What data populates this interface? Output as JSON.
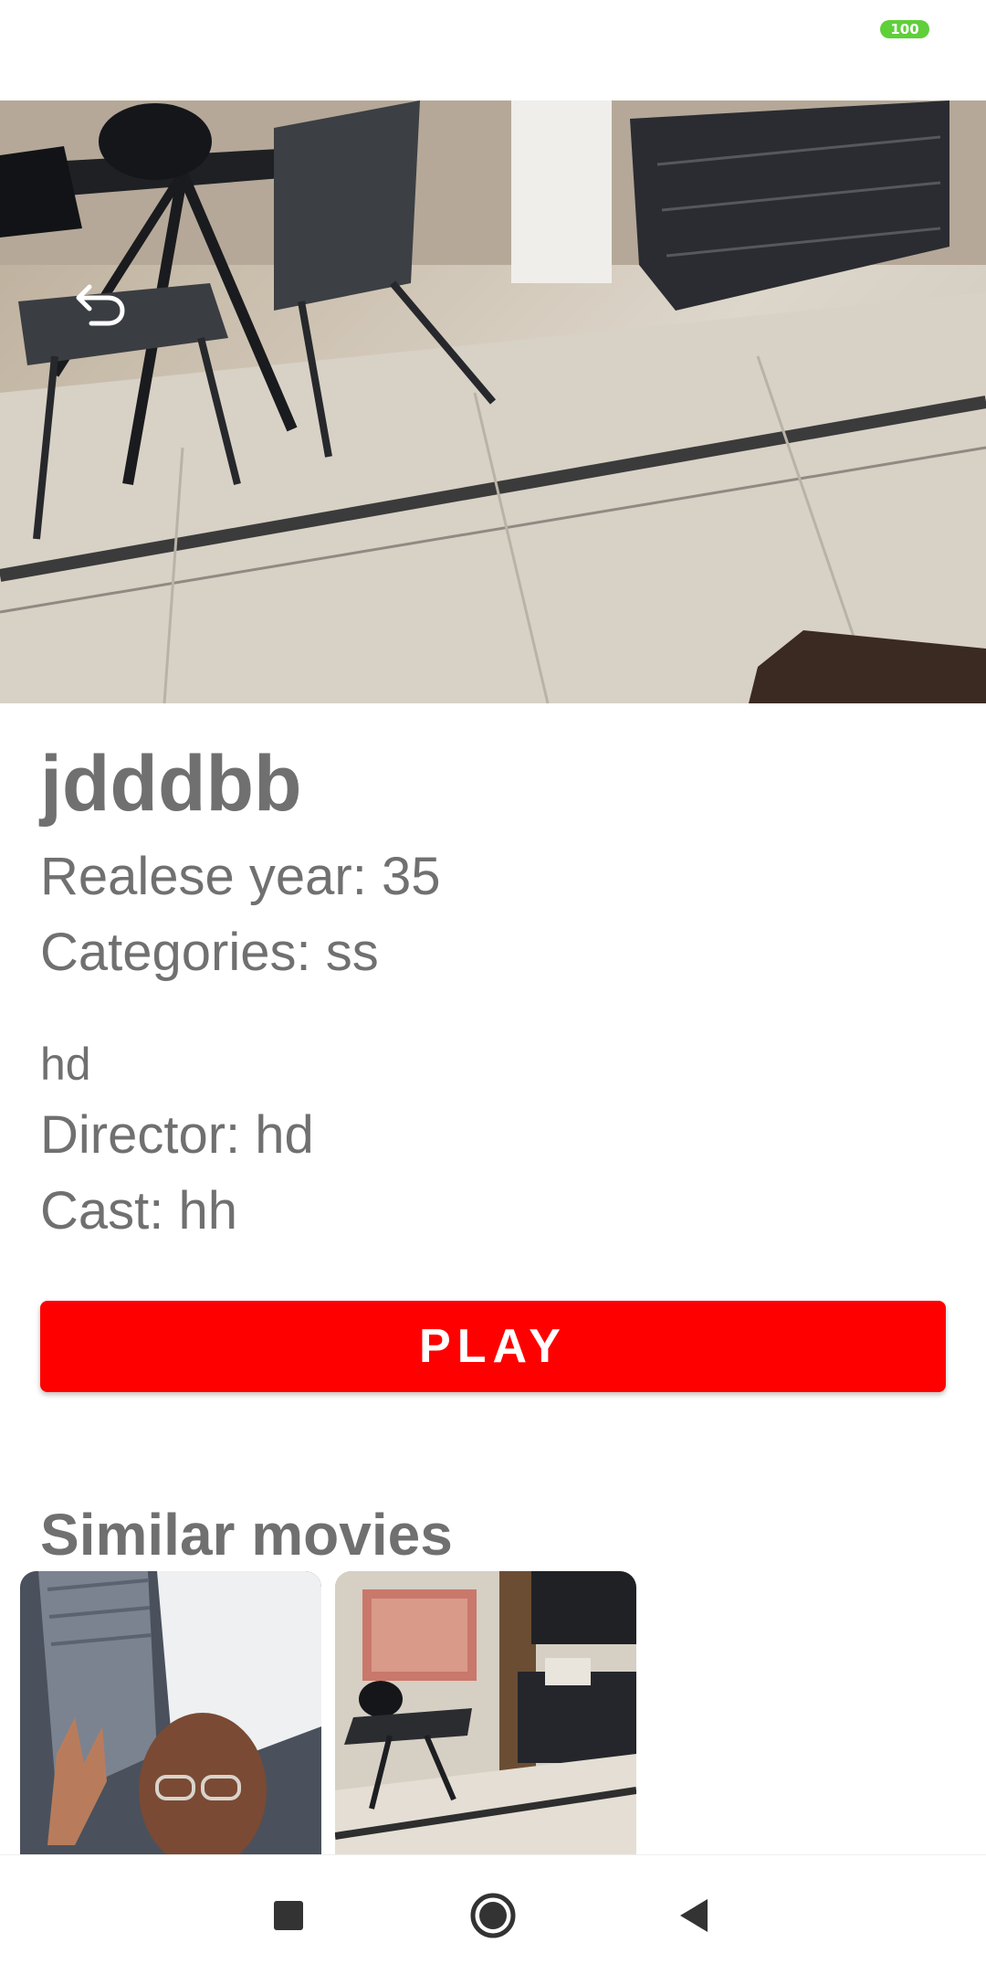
{
  "status_bar": {
    "battery_level": "100",
    "battery_color": "#5fcf3a"
  },
  "hero": {
    "back_icon": "undo-arrow-icon"
  },
  "movie": {
    "title": "jdddbb",
    "release_year": "Realese year: 35",
    "categories": "Categories: ss",
    "description": "hd",
    "director": "Director: hd",
    "cast": "Cast: hh"
  },
  "actions": {
    "play_label": "PLAY",
    "play_color": "#ff0000"
  },
  "similar": {
    "title": "Similar movies",
    "items": [
      {
        "thumb_icon": "selfie-thumbnail"
      },
      {
        "thumb_icon": "room-thumbnail"
      }
    ]
  },
  "nav_bar": {
    "recents_icon": "square-icon",
    "home_icon": "circle-icon",
    "back_icon": "triangle-back-icon"
  }
}
